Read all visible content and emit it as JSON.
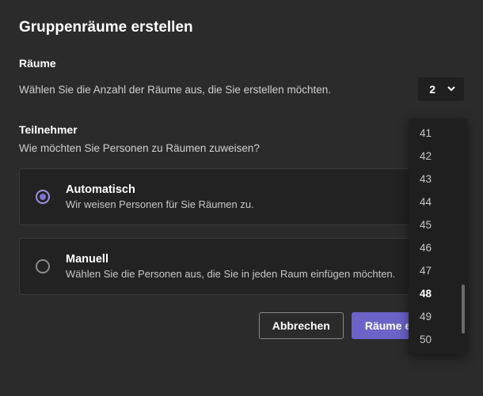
{
  "title": "Gruppenräume erstellen",
  "rooms": {
    "label": "Räume",
    "desc": "Wählen Sie die Anzahl der Räume aus, die Sie erstellen möchten.",
    "selected": "2"
  },
  "participants": {
    "label": "Teilnehmer",
    "desc": "Wie möchten Sie Personen zu Räumen zuweisen?"
  },
  "options": {
    "auto": {
      "title": "Automatisch",
      "desc": "Wir weisen Personen für Sie Räumen zu."
    },
    "manual": {
      "title": "Manuell",
      "desc": "Wählen Sie die Personen aus, die Sie in jeden Raum einfügen möchten."
    }
  },
  "buttons": {
    "cancel": "Abbrechen",
    "create": "Räume erstellen"
  },
  "dropdown": {
    "items": [
      "41",
      "42",
      "43",
      "44",
      "45",
      "46",
      "47",
      "48",
      "49",
      "50"
    ],
    "highlighted": "48"
  }
}
